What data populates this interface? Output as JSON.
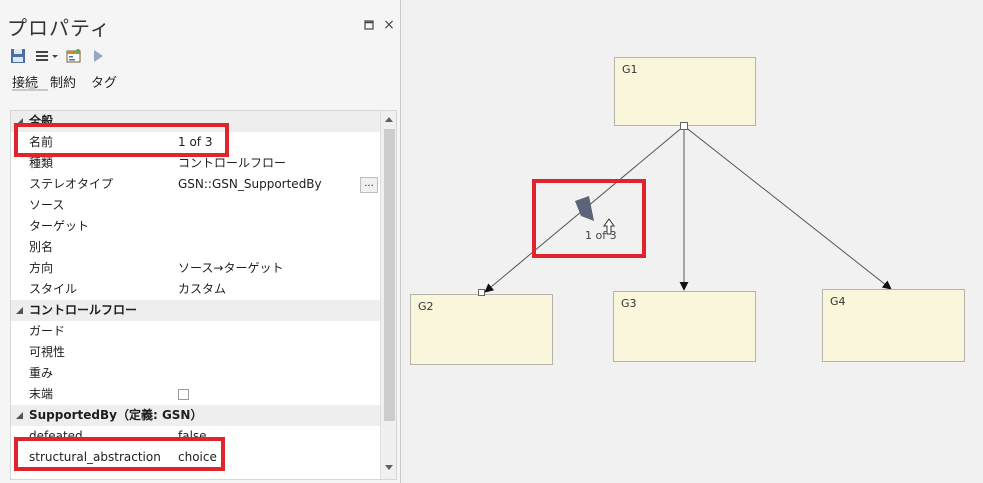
{
  "panel": {
    "title": "プロパティ",
    "close_glyph": "×",
    "tabs": [
      "接続",
      "制約",
      "タグ"
    ],
    "categories": {
      "general": "全般",
      "control_flow": "コントロールフロー",
      "supported_by": "SupportedBy（定義: GSN）"
    },
    "rows": {
      "name": {
        "label": "名前",
        "value": "1 of 3"
      },
      "kind": {
        "label": "種類",
        "value": "コントロールフロー"
      },
      "stereotype": {
        "label": "ステレオタイプ",
        "value": "GSN::GSN_SupportedBy",
        "button": "..."
      },
      "source": {
        "label": "ソース",
        "value": ""
      },
      "target": {
        "label": "ターゲット",
        "value": ""
      },
      "alias": {
        "label": "別名",
        "value": ""
      },
      "direction": {
        "label": "方向",
        "value": "ソース→ターゲット"
      },
      "style": {
        "label": "スタイル",
        "value": "カスタム"
      },
      "guard": {
        "label": "ガード",
        "value": ""
      },
      "visibility": {
        "label": "可視性",
        "value": ""
      },
      "weight": {
        "label": "重み",
        "value": ""
      },
      "end": {
        "label": "末端",
        "value": ""
      },
      "defeated": {
        "label": "defeated",
        "value": "false"
      },
      "structural_abstraction": {
        "label": "structural_abstraction",
        "value": "choice"
      }
    }
  },
  "diagram": {
    "nodes": [
      "G1",
      "G2",
      "G3",
      "G4"
    ],
    "connector_label": "1 of 3"
  },
  "colors": {
    "highlight": "#e0242b",
    "node_fill": "#faf6dc",
    "node_border": "#b4b4a8",
    "diamond": "#5b6478"
  },
  "icons": [
    "save-icon",
    "menu-icon",
    "dropdown-icon",
    "properties-icon",
    "play-icon",
    "restore-icon",
    "close-icon"
  ]
}
